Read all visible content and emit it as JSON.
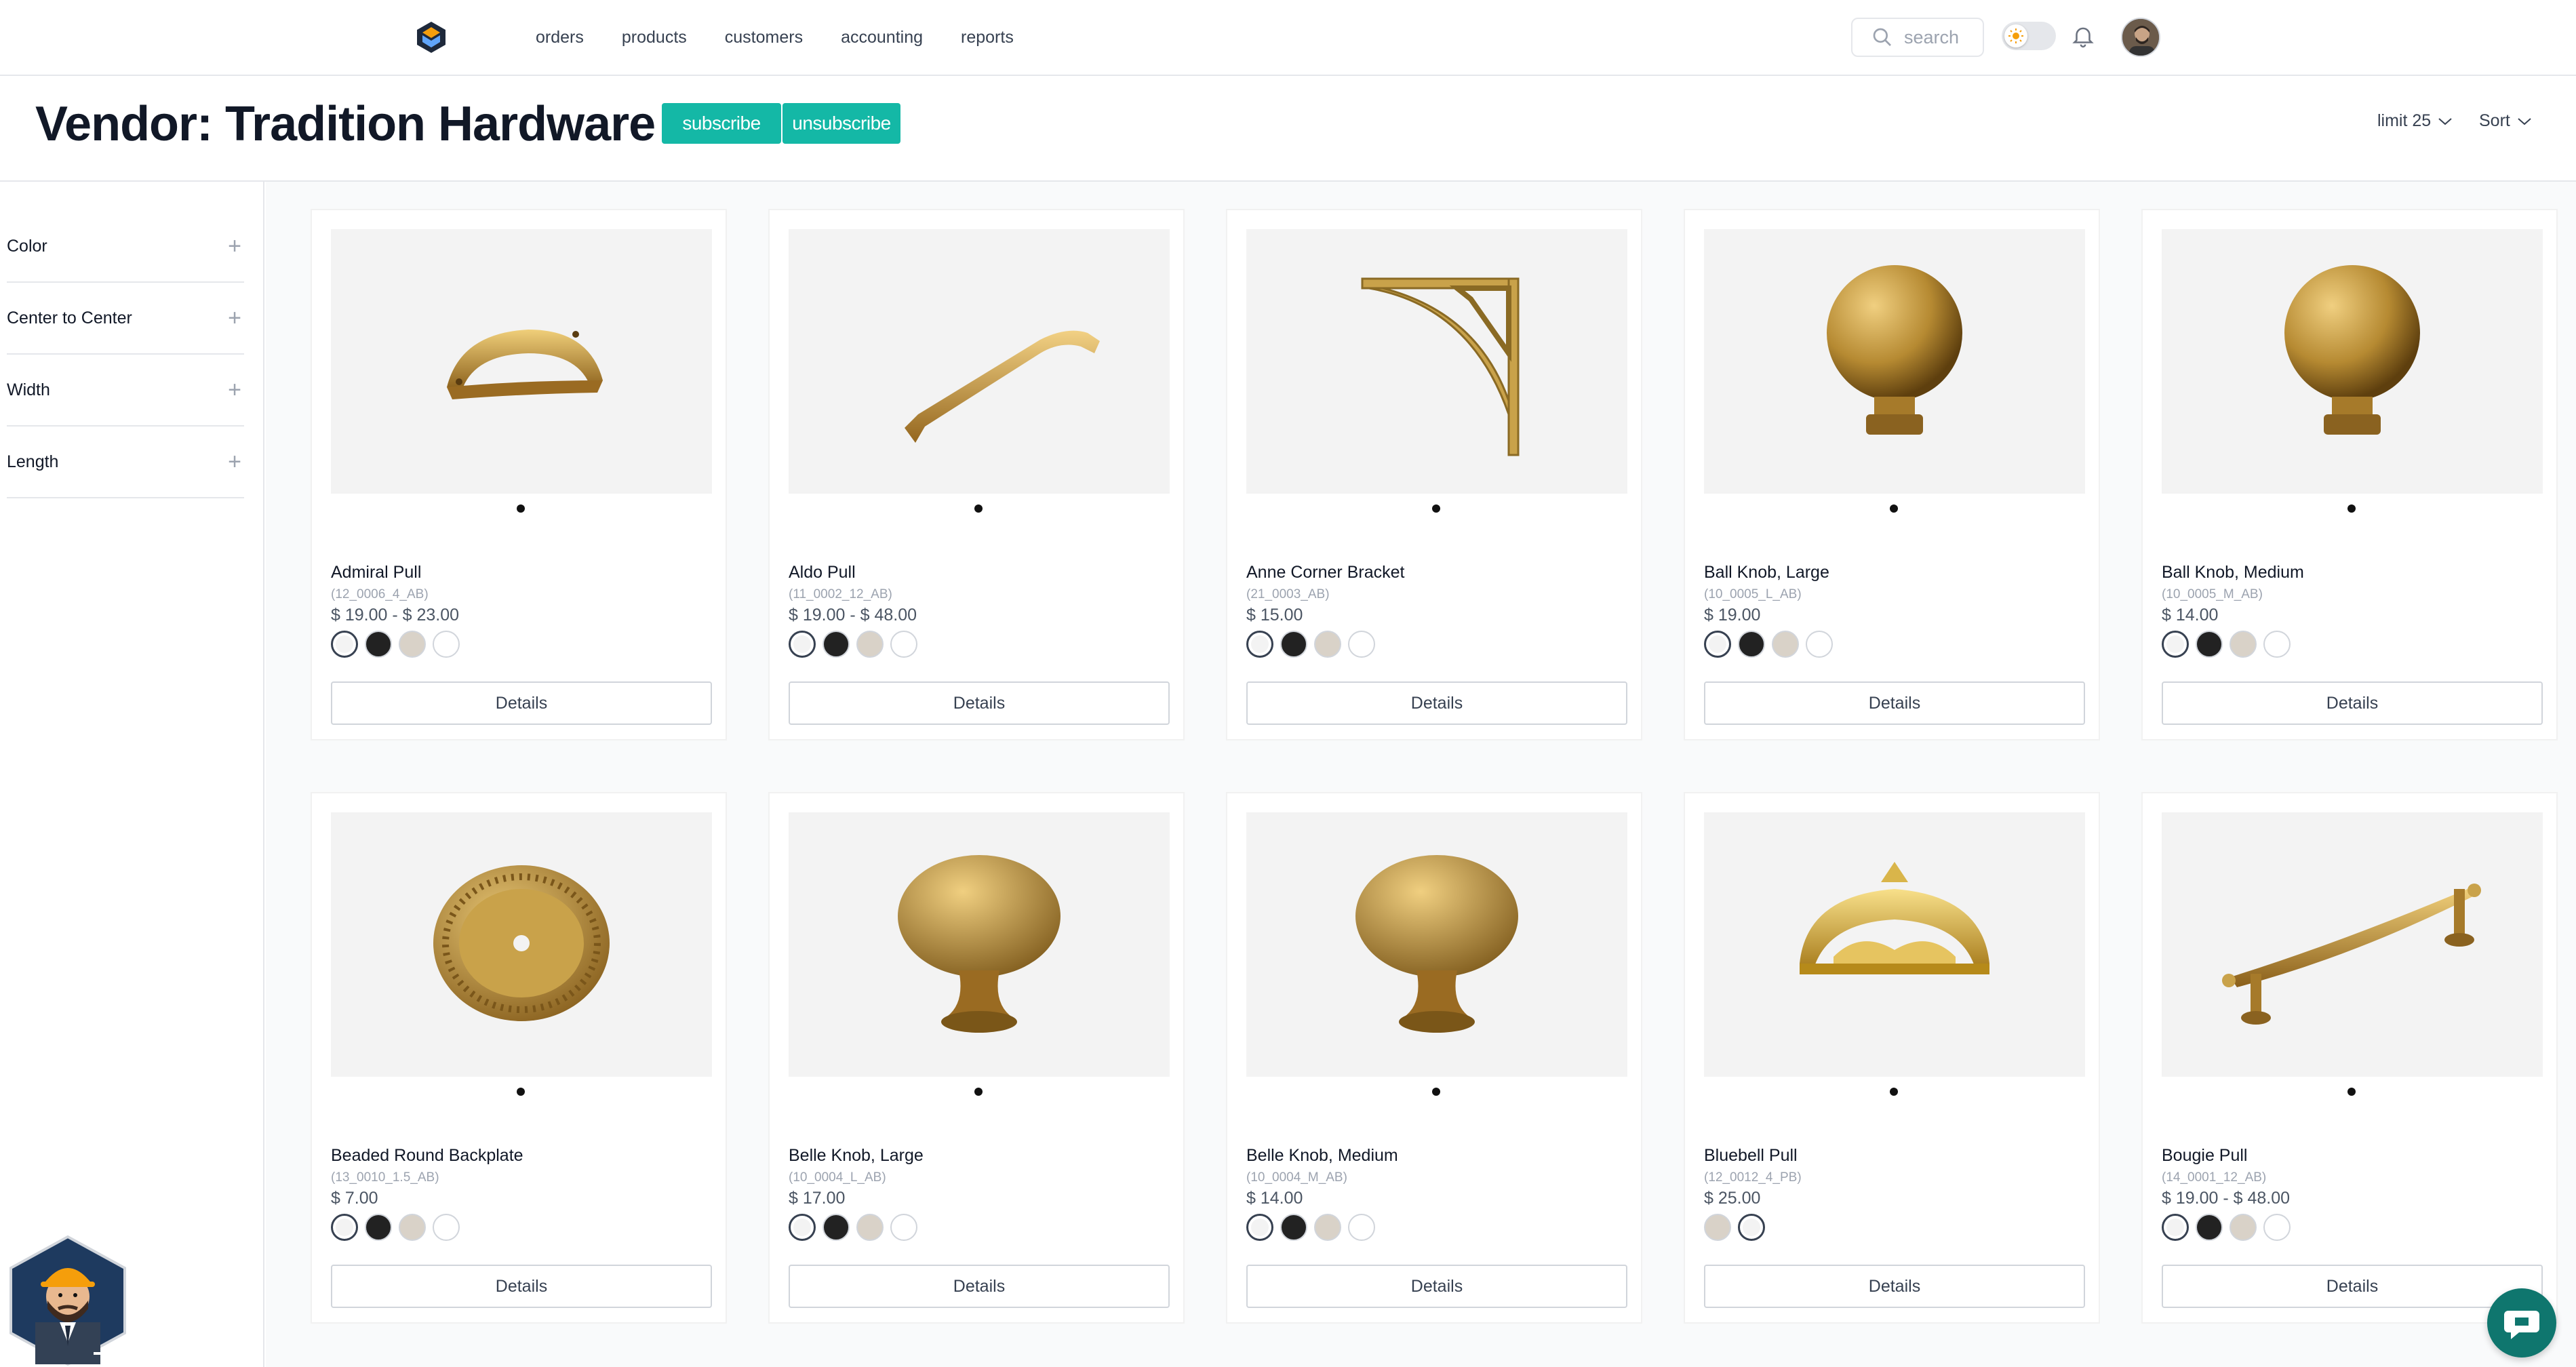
{
  "nav": {
    "links": [
      "orders",
      "products",
      "customers",
      "accounting",
      "reports"
    ],
    "search_placeholder": "search"
  },
  "header": {
    "title": "Vendor: Tradition Hardware",
    "subscribe_label": "subscribe",
    "unsubscribe_label": "unsubscribe",
    "limit_label": "limit 25",
    "sort_label": "Sort"
  },
  "sidebar": {
    "filters": [
      "Color",
      "Center to Center",
      "Width",
      "Length"
    ]
  },
  "colors": {
    "accent": "#14b8a6",
    "brass": "#c9a24a",
    "swatch_brass": "#f3f3f3",
    "swatch_black": "#222222",
    "swatch_bronze": "#d9d2c8",
    "swatch_white": "#ffffff"
  },
  "products": [
    {
      "name": "Admiral Pull",
      "sku": "(12_0006_4_AB)",
      "price": "$ 19.00 - $ 23.00",
      "swatches": [
        "sel",
        "black",
        "beige",
        "white"
      ],
      "icon": "cup-pull",
      "details": "Details"
    },
    {
      "name": "Aldo Pull",
      "sku": "(11_0002_12_AB)",
      "price": "$ 19.00 - $ 48.00",
      "swatches": [
        "sel",
        "black",
        "beige",
        "white"
      ],
      "icon": "bar-pull",
      "details": "Details"
    },
    {
      "name": "Anne Corner Bracket",
      "sku": "(21_0003_AB)",
      "price": "$ 15.00",
      "swatches": [
        "sel",
        "black",
        "beige",
        "white"
      ],
      "icon": "bracket",
      "details": "Details"
    },
    {
      "name": "Ball Knob, Large",
      "sku": "(10_0005_L_AB)",
      "price": "$ 19.00",
      "swatches": [
        "sel",
        "black",
        "beige",
        "white"
      ],
      "icon": "ball-knob",
      "details": "Details"
    },
    {
      "name": "Ball Knob, Medium",
      "sku": "(10_0005_M_AB)",
      "price": "$ 14.00",
      "swatches": [
        "sel",
        "black",
        "beige",
        "white"
      ],
      "icon": "ball-knob",
      "details": "Details"
    },
    {
      "name": "Beaded Round Backplate",
      "sku": "(13_0010_1.5_AB)",
      "price": "$ 7.00",
      "swatches": [
        "sel",
        "black",
        "beige",
        "white"
      ],
      "icon": "backplate",
      "details": "Details"
    },
    {
      "name": "Belle Knob, Large",
      "sku": "(10_0004_L_AB)",
      "price": "$ 17.00",
      "swatches": [
        "sel",
        "black",
        "beige",
        "white"
      ],
      "icon": "mushroom-knob",
      "details": "Details"
    },
    {
      "name": "Belle Knob, Medium",
      "sku": "(10_0004_M_AB)",
      "price": "$ 14.00",
      "swatches": [
        "sel",
        "black",
        "beige",
        "white"
      ],
      "icon": "mushroom-knob",
      "details": "Details"
    },
    {
      "name": "Bluebell Pull",
      "sku": "(12_0012_4_PB)",
      "price": "$ 25.00",
      "swatches": [
        "beige",
        "sel"
      ],
      "icon": "ornate-cup",
      "details": "Details"
    },
    {
      "name": "Bougie Pull",
      "sku": "(14_0001_12_AB)",
      "price": "$ 19.00 - $ 48.00",
      "swatches": [
        "sel",
        "black",
        "beige",
        "white"
      ],
      "icon": "ornate-bar",
      "details": "Details"
    }
  ]
}
